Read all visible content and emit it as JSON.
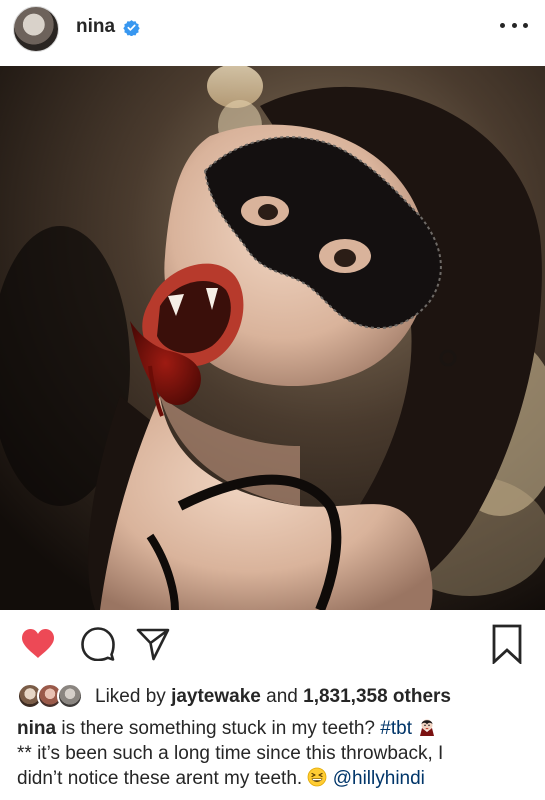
{
  "post": {
    "username": "nina",
    "verified": true,
    "more_icon": "more-horizontal-icon"
  },
  "actions": {
    "like_icon": "heart-icon",
    "liked": true,
    "comment_icon": "comment-icon",
    "share_icon": "share-icon",
    "save_icon": "bookmark-icon",
    "like_color": "#ed4956"
  },
  "likes": {
    "prefix": "Liked by",
    "user": "jaytewake",
    "middle": "and",
    "count": "1,831,358 others"
  },
  "caption": {
    "user": "nina",
    "text_1": " is there something stuck in my teeth? ",
    "hashtag": "#tbt",
    "emoji_1": "vampire-emoji",
    "text_2": "** it’s been such a long time since this throwback, I",
    "text_3": "didn’t notice these arent my teeth. ",
    "emoji_2": "grinning-squinting-face-emoji",
    "mention": "@hillyhindi"
  },
  "colors": {
    "link": "#003569",
    "verified": "#3897f0",
    "text": "#262626"
  }
}
